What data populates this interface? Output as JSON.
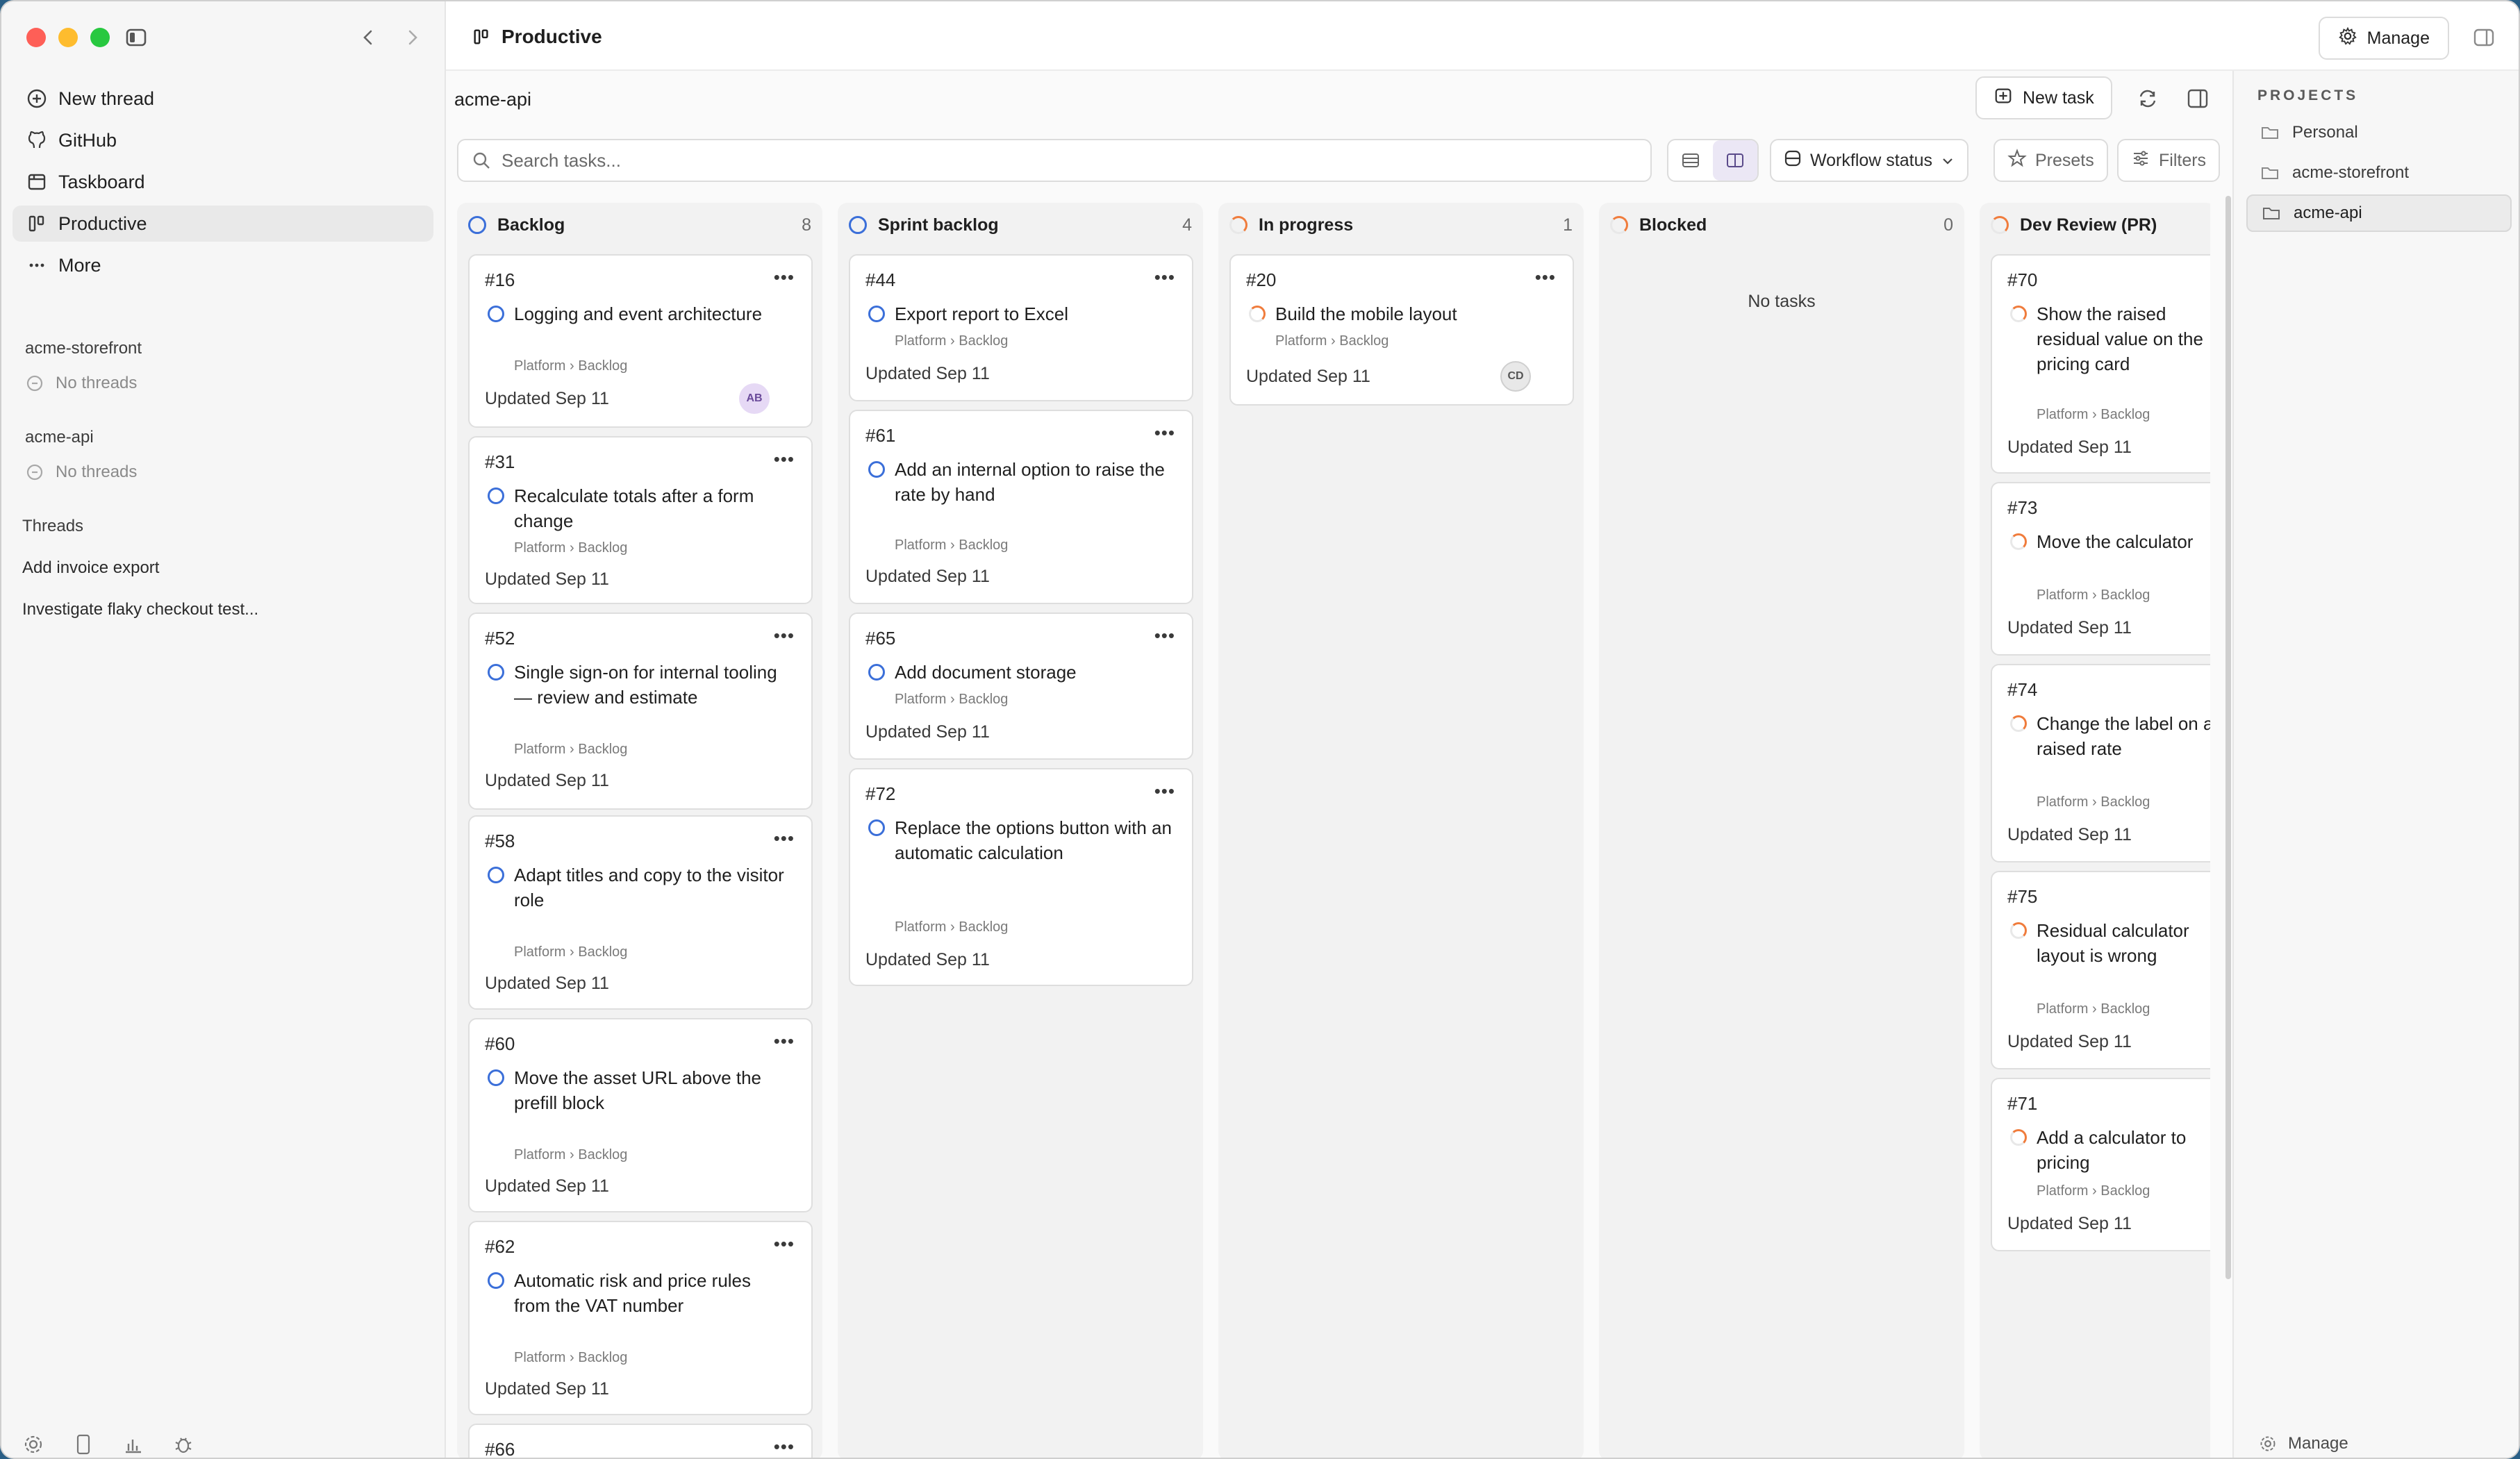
{
  "app": {
    "title": "Productive"
  },
  "sidebar": {
    "nav": [
      {
        "label": "New thread",
        "icon": "plus-circle-icon"
      },
      {
        "label": "GitHub",
        "icon": "github-icon"
      },
      {
        "label": "Taskboard",
        "icon": "taskboard-icon"
      },
      {
        "label": "Productive",
        "icon": "board-icon"
      },
      {
        "label": "More",
        "icon": "ellipsis-icon"
      }
    ],
    "projects": [
      {
        "name": "acme-storefront",
        "status": "No threads"
      },
      {
        "name": "acme-api",
        "status": "No threads"
      }
    ],
    "threads_heading": "Threads",
    "threads": [
      "Add invoice export",
      "Investigate flaky checkout test..."
    ]
  },
  "header": {
    "manage_label": "Manage"
  },
  "main": {
    "project_name": "acme-api",
    "new_task_label": "New task",
    "search_placeholder": "Search tasks...",
    "workflow_label": "Workflow status",
    "presets_label": "Presets",
    "filters_label": "Filters"
  },
  "board": {
    "columns": [
      {
        "name": "Backlog",
        "count": "8",
        "status": "todo",
        "cards": [
          {
            "num": "#16",
            "title": "Logging and event architecture",
            "path": "Platform › Backlog",
            "updated": "Updated Sep 11",
            "avatar": "AB"
          },
          {
            "num": "#31",
            "title": "Recalculate totals after a form change",
            "path": "Platform › Backlog",
            "updated": "Updated Sep 11"
          },
          {
            "num": "#52",
            "title": "Single sign-on for internal tooling — review and estimate",
            "path": "Platform › Backlog",
            "updated": "Updated Sep 11"
          },
          {
            "num": "#58",
            "title": "Adapt titles and copy to the visitor role",
            "path": "Platform › Backlog",
            "updated": "Updated Sep 11"
          },
          {
            "num": "#60",
            "title": "Move the asset URL above the prefill block",
            "path": "Platform › Backlog",
            "updated": "Updated Sep 11"
          },
          {
            "num": "#62",
            "title": "Automatic risk and price rules from the VAT number",
            "path": "Platform › Backlog",
            "updated": "Updated Sep 11"
          },
          {
            "num": "#66",
            "title": "",
            "path": "",
            "updated": ""
          }
        ]
      },
      {
        "name": "Sprint backlog",
        "count": "4",
        "status": "todo",
        "cards": [
          {
            "num": "#44",
            "title": "Export report to Excel",
            "path": "Platform › Backlog",
            "updated": "Updated Sep 11"
          },
          {
            "num": "#61",
            "title": "Add an internal option to raise the rate by hand",
            "path": "Platform › Backlog",
            "updated": "Updated Sep 11"
          },
          {
            "num": "#65",
            "title": "Add document storage",
            "path": "Platform › Backlog",
            "updated": "Updated Sep 11"
          },
          {
            "num": "#72",
            "title": "Replace the options button with an automatic calculation",
            "path": "Platform › Backlog",
            "updated": "Updated Sep 11"
          }
        ]
      },
      {
        "name": "In progress",
        "count": "1",
        "status": "progress",
        "cards": [
          {
            "num": "#20",
            "title": "Build the mobile layout",
            "path": "Platform › Backlog",
            "updated": "Updated Sep 11",
            "avatar": "CD"
          }
        ]
      },
      {
        "name": "Blocked",
        "count": "0",
        "status": "progress",
        "empty_label": "No tasks",
        "cards": []
      },
      {
        "name": "Dev Review (PR)",
        "count": "",
        "status": "progress",
        "cards": [
          {
            "num": "#70",
            "title": "Show the raised residual value on the pricing card",
            "path": "Platform › Backlog",
            "updated": "Updated Sep 11"
          },
          {
            "num": "#73",
            "title": "Move the calculator",
            "path": "Platform › Backlog",
            "updated": "Updated Sep 11"
          },
          {
            "num": "#74",
            "title": "Change the label on a raised rate",
            "path": "Platform › Backlog",
            "updated": "Updated Sep 11"
          },
          {
            "num": "#75",
            "title": "Residual calculator layout is wrong",
            "path": "Platform › Backlog",
            "updated": "Updated Sep 11"
          },
          {
            "num": "#71",
            "title": "Add a calculator to pricing",
            "path": "Platform › Backlog",
            "updated": "Updated Sep 11"
          }
        ]
      }
    ]
  },
  "projects_panel": {
    "heading": "PROJECTS",
    "items": [
      "Personal",
      "acme-storefront",
      "acme-api"
    ],
    "active": "acme-api",
    "manage_label": "Manage"
  },
  "colors": {
    "todo_ring": "#3b6fd9",
    "progress_ring": "#f07c3c",
    "avatar_ab": "#e6d9f5",
    "avatar_cd": "#e8e8e8"
  }
}
